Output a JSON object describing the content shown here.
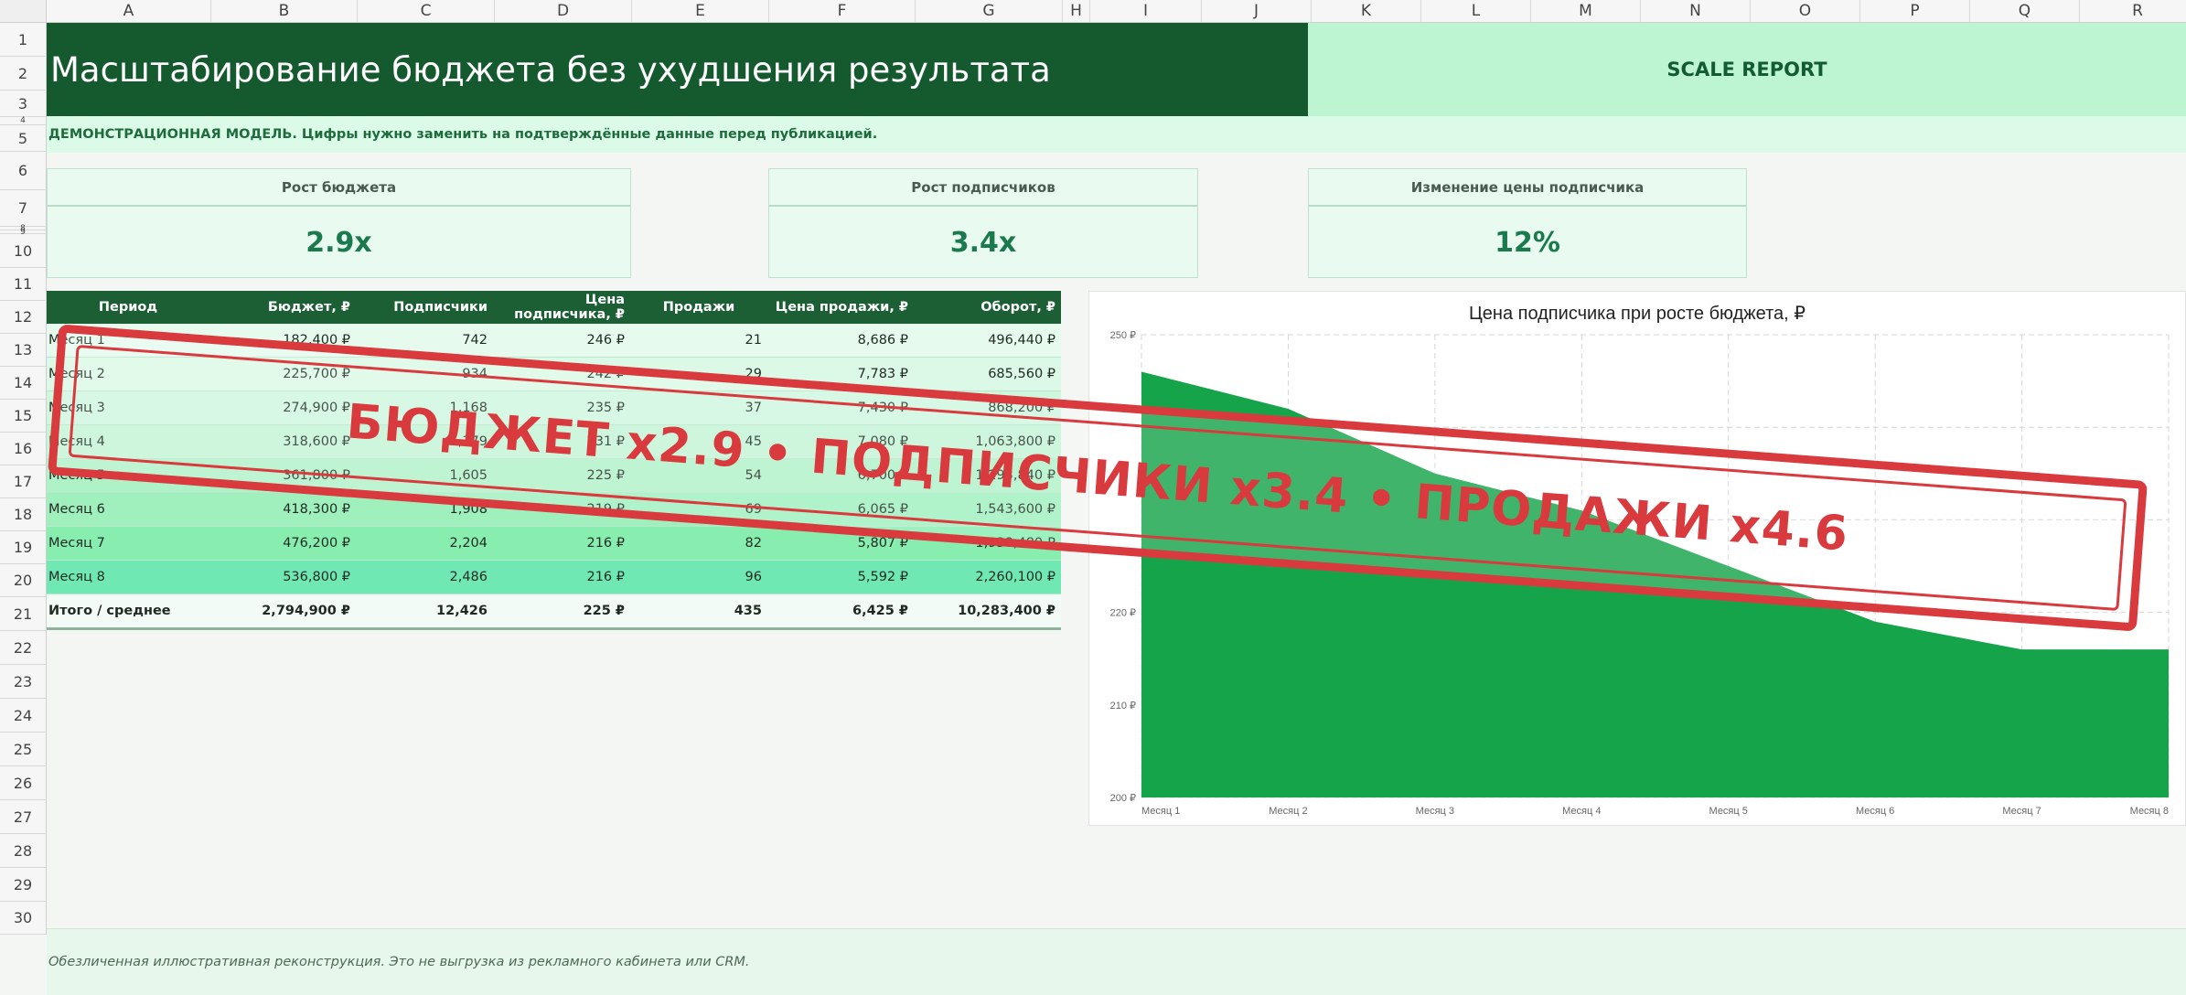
{
  "columns": [
    "A",
    "B",
    "C",
    "D",
    "E",
    "F",
    "G",
    "H",
    "I",
    "J",
    "K",
    "L",
    "M",
    "N",
    "O",
    "P",
    "Q",
    "R"
  ],
  "rows": [
    "1",
    "2",
    "3",
    "4",
    "5",
    "6",
    "7",
    "8",
    "9",
    "10",
    "11",
    "12",
    "13",
    "14",
    "15",
    "16",
    "17",
    "18",
    "19",
    "20",
    "21",
    "22",
    "23",
    "24",
    "25",
    "26",
    "27",
    "28",
    "29",
    "30"
  ],
  "title": "Масштабирование бюджета без ухудшения результата",
  "report_label": "SCALE REPORT",
  "note": "ДЕМОНСТРАЦИОННАЯ МОДЕЛЬ. Цифры нужно заменить на подтверждённые данные перед публикацией.",
  "kpis": [
    {
      "label": "Рост бюджета",
      "value": "2.9x"
    },
    {
      "label": "Рост подписчиков",
      "value": "3.4x"
    },
    {
      "label": "Изменение цены подписчика",
      "value": "12%"
    }
  ],
  "table": {
    "headers": [
      "Период",
      "Бюджет, ₽",
      "Подписчики",
      "Цена подписчика, ₽",
      "Продажи",
      "Цена продажи, ₽",
      "Оборот, ₽"
    ],
    "rows": [
      [
        "Месяц 1",
        "182,400 ₽",
        "742",
        "246 ₽",
        "21",
        "8,686 ₽",
        "496,440 ₽"
      ],
      [
        "Месяц 2",
        "225,700 ₽",
        "934",
        "242 ₽",
        "29",
        "7,783 ₽",
        "685,560 ₽"
      ],
      [
        "Месяц 3",
        "274,900 ₽",
        "1,168",
        "235 ₽",
        "37",
        "7,430 ₽",
        "868,200 ₽"
      ],
      [
        "Месяц 4",
        "318,600 ₽",
        "1,379",
        "231 ₽",
        "45",
        "7,080 ₽",
        "1,063,800 ₽"
      ],
      [
        "Месяц 5",
        "361,800 ₽",
        "1,605",
        "225 ₽",
        "54",
        "6,700 ₽",
        "1,293,840 ₽"
      ],
      [
        "Месяц 6",
        "418,300 ₽",
        "1,908",
        "219 ₽",
        "69",
        "6,065 ₽",
        "1,543,600 ₽"
      ],
      [
        "Месяц 7",
        "476,200 ₽",
        "2,204",
        "216 ₽",
        "82",
        "5,807 ₽",
        "1,938,480 ₽"
      ],
      [
        "Месяц 8",
        "536,800 ₽",
        "2,486",
        "216 ₽",
        "96",
        "5,592 ₽",
        "2,260,100 ₽"
      ]
    ],
    "total": [
      "Итого / среднее",
      "2,794,900 ₽",
      "12,426",
      "225 ₽",
      "435",
      "6,425 ₽",
      "10,283,400 ₽"
    ]
  },
  "colors": {
    "row_fills": [
      "#e6fbee",
      "#dbf9e6",
      "#cff7de",
      "#c3f5d6",
      "#b0f2c8",
      "#9ff0bd",
      "#88eeb0",
      "#6fe8b4"
    ],
    "area": "#16a44a",
    "stamp": "#d83a3e"
  },
  "chart_data": {
    "type": "area",
    "title": "Цена подписчика при росте бюджета, ₽",
    "categories": [
      "Месяц 1",
      "Месяц 2",
      "Месяц 3",
      "Месяц 4",
      "Месяц 5",
      "Месяц 6",
      "Месяц 7",
      "Месяц 8"
    ],
    "series": [
      {
        "values": [
          246,
          242,
          235,
          231,
          225,
          219,
          216,
          216
        ]
      }
    ],
    "ylim": [
      200,
      250
    ],
    "yticks": [
      200,
      210,
      220,
      230,
      240,
      250
    ],
    "ytick_labels": [
      "200 ₽",
      "210 ₽",
      "220 ₽",
      "",
      "",
      "250 ₽"
    ],
    "grid": true,
    "xlabel": "",
    "ylabel": ""
  },
  "stamp_text": "БЮДЖЕТ x2.9 • ПОДПИСЧИКИ x3.4 • ПРОДАЖИ x4.6",
  "footer": "Обезличенная иллюстративная реконструкция. Это не выгрузка из рекламного кабинета или CRM."
}
